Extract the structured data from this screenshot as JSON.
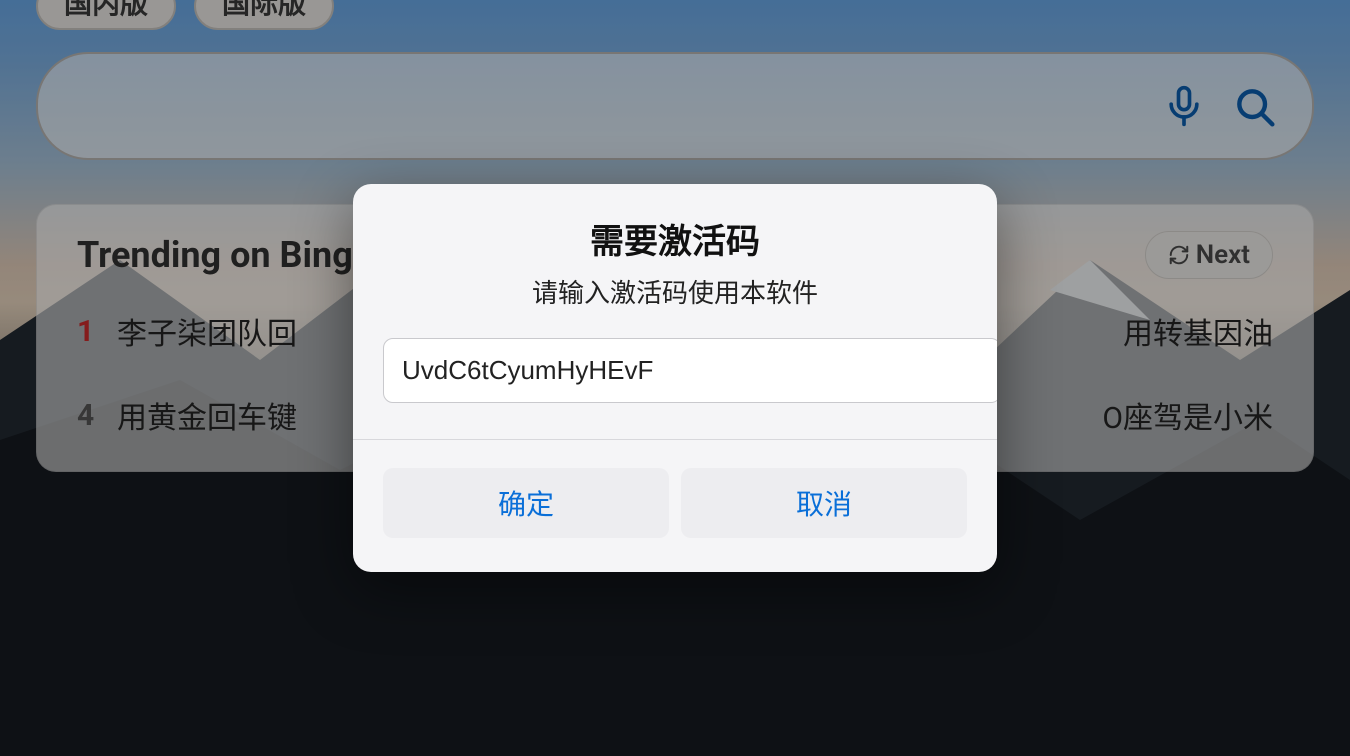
{
  "tabs": {
    "domestic": "国内版",
    "international": "国际版"
  },
  "search": {
    "placeholder": ""
  },
  "trending": {
    "title": "Trending on Bing",
    "next_label": "Next",
    "items": [
      {
        "rank": "1",
        "hot": true,
        "text": "李子柒团队回"
      },
      {
        "rank": "",
        "hot": false,
        "text": "用转基因油"
      },
      {
        "rank": "",
        "hot": false,
        "text": ""
      },
      {
        "rank": "4",
        "hot": false,
        "text": "用黄金回车键"
      },
      {
        "rank": "",
        "hot": false,
        "text": ""
      },
      {
        "rank": "",
        "hot": false,
        "text": "O座驾是小米"
      }
    ]
  },
  "modal": {
    "title": "需要激活码",
    "subtitle": "请输入激活码使用本软件",
    "input_value": "UvdC6tCyumHyHEvF",
    "confirm": "确定",
    "cancel": "取消"
  },
  "colors": {
    "accent": "#0a6fd8",
    "rank_red": "#cc2b2b"
  }
}
